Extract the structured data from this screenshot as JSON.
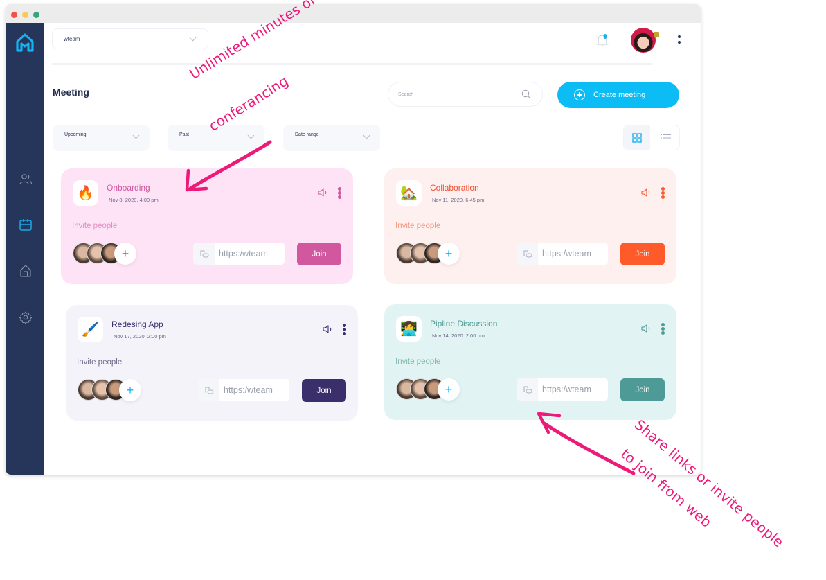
{
  "window": {
    "title_bar_buttons": [
      "close",
      "minimize",
      "maximize"
    ]
  },
  "sidebar": {
    "logo": "wteam-logo",
    "items": [
      {
        "name": "users",
        "icon": "users-icon",
        "active": false
      },
      {
        "name": "calendar",
        "icon": "calendar-icon",
        "active": true
      },
      {
        "name": "home",
        "icon": "home-icon",
        "active": false
      },
      {
        "name": "settings",
        "icon": "gear-icon",
        "active": false
      }
    ]
  },
  "header": {
    "team_select_value": "wteam",
    "notification_icon": "bell-icon",
    "avatar": "user-avatar",
    "menu_icon": "kebab-icon"
  },
  "page": {
    "title": "Meeting",
    "search_placeholder": "Search",
    "create_button_label": "Create meeting",
    "filters": [
      "Upcoming",
      "Past",
      "Date range"
    ],
    "view_modes": [
      {
        "name": "grid",
        "active": true
      },
      {
        "name": "list",
        "active": false
      }
    ]
  },
  "colors": {
    "accent": "#0bbcf5",
    "sidebar": "#25365a",
    "annotation": "#ee1a7a"
  },
  "meetings": [
    {
      "title": "Onboarding",
      "date": "Nov 8, 2020. 4:00 pm",
      "emoji": "🔥",
      "invite_label": "Invite people",
      "link": "https:/wteam",
      "join_label": "Join",
      "bg": "#fde3f5",
      "accent": "#d1579e",
      "title_color": "#d1579e",
      "invite_color": "#e58cc0"
    },
    {
      "title": "Collaboration",
      "date": "Nov 11, 2020. 6:45 pm",
      "emoji": "🏡",
      "invite_label": "Invite people",
      "link": "https:/wteam",
      "join_label": "Join",
      "bg": "#fdf0ee",
      "accent": "#ff5a2a",
      "title_color": "#f24f33",
      "invite_color": "#f59a82"
    },
    {
      "title": "Redesing App",
      "date": "Nov 17, 2020. 2:00 pm",
      "emoji": "🖌️",
      "invite_label": "Invite people",
      "link": "https:/wteam",
      "join_label": "Join",
      "bg": "#f5f3fa",
      "accent": "#3a2e6b",
      "title_color": "#3a2e6b",
      "invite_color": "#6e6a8c"
    },
    {
      "title": "Pipline Discussion",
      "date": "Nov 14, 2020. 2:00 pm",
      "emoji": "👩‍💻",
      "invite_label": "Invite people",
      "link": "https:/wteam",
      "join_label": "Join",
      "bg": "#e1f3f2",
      "accent": "#4e9a96",
      "title_color": "#4e9a96",
      "invite_color": "#82b8b4"
    }
  ],
  "annotations": {
    "top_line1": "Unlimited minutes of",
    "top_line2": "conferancing",
    "bottom_line1": "Share links or invite people",
    "bottom_line2": "to join from web"
  }
}
